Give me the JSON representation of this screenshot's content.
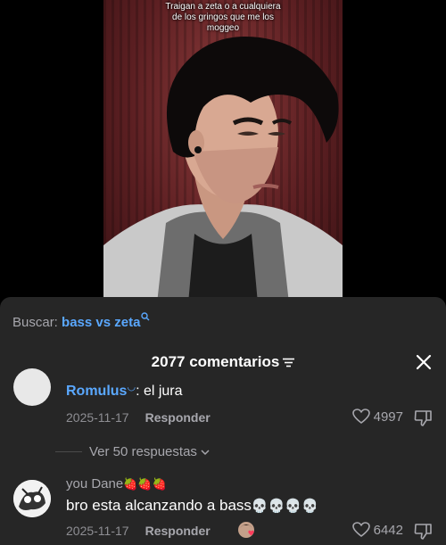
{
  "video": {
    "caption": [
      "Traigan a zeta o a cualquiera",
      "de los gringos que me los",
      "moggeo"
    ]
  },
  "search": {
    "label": "Buscar:",
    "term": "bass vs zeta"
  },
  "comments_header": {
    "count": "2077 comentarios"
  },
  "comments": [
    {
      "user": "Romulus",
      "text": ": el jura",
      "date": "2025-11-17",
      "reply_label": "Responder",
      "likes": "4997",
      "view_replies": "Ver 50 respuestas"
    },
    {
      "user": "you Dane",
      "user_emoji": "🍓🍓🍓",
      "text": "bro esta alcanzando a bass",
      "text_emoji": "💀💀💀💀",
      "date": "2025-11-17",
      "reply_label": "Responder",
      "likes": "6442"
    }
  ],
  "colors": {
    "panel_bg": "#262626",
    "accent": "#5aa8ff",
    "muted": "#a7a7ad"
  }
}
